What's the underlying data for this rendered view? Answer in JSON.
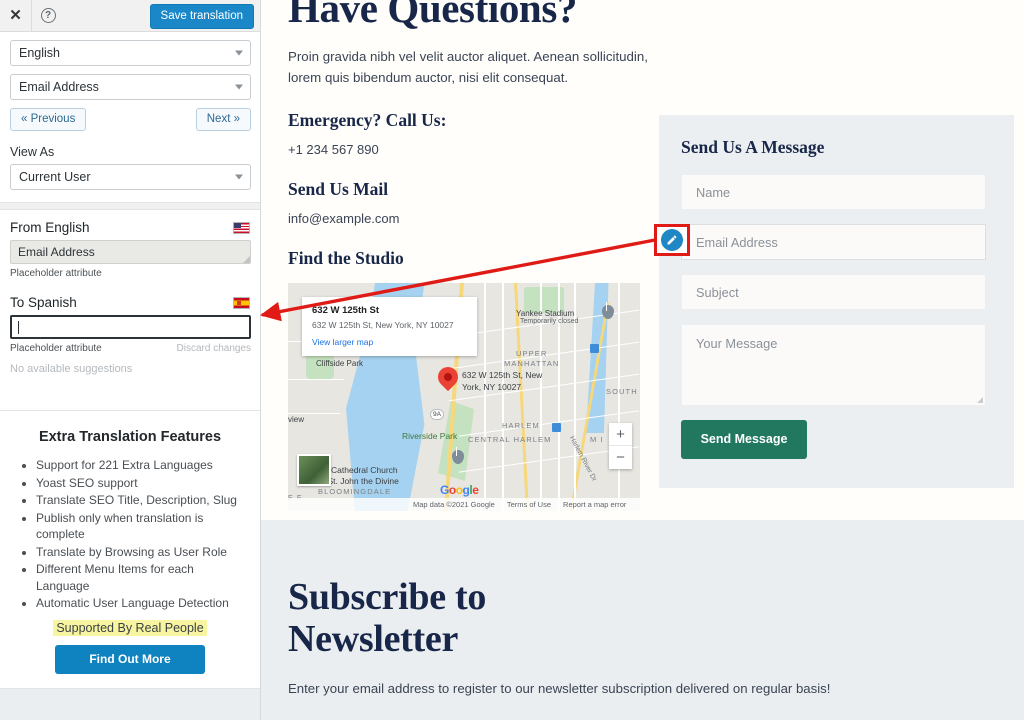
{
  "sidebar": {
    "toolbar": {
      "close_label": "✕",
      "help_label": "?",
      "save_label": "Save translation"
    },
    "language_select": "English",
    "string_select": "Email Address",
    "prev_label": "« Previous",
    "next_label": "Next »",
    "view_as_label": "View As",
    "view_as_value": "Current User",
    "translation": {
      "from_label": "From English",
      "from_value": "Email Address",
      "from_attr_note": "Placeholder attribute",
      "to_label": "To Spanish",
      "to_value": "",
      "to_attr_note": "Placeholder attribute",
      "discard_label": "Discard changes",
      "suggestions": "No available suggestions"
    },
    "extra_features": {
      "title": "Extra Translation Features",
      "items": [
        "Support for 221 Extra Languages",
        "Yoast SEO support",
        "Translate SEO Title, Description, Slug",
        "Publish only when translation is complete",
        "Translate by Browsing as User Role",
        "Different Menu Items for each Language",
        "Automatic User Language Detection"
      ],
      "supported_by": "Supported By Real People",
      "cta_label": "Find Out More"
    }
  },
  "page": {
    "heading": "Have Questions?",
    "lede": "Proin gravida nibh vel velit auctor aliquet. Aenean sollicitudin, lorem quis bibendum auctor, nisi elit consequat.",
    "emergency_label": "Emergency? Call Us:",
    "phone": "+1 234 567 890",
    "mail_label": "Send Us Mail",
    "email": "info@example.com",
    "studio_label": "Find the Studio"
  },
  "map": {
    "card_title": "632 W 125th St",
    "card_address": "632 W 125th St, New York, NY 10027",
    "view_larger": "View larger map",
    "pin_label": "632 W 125th St, New York, NY 10027",
    "labels": {
      "yankee_stadium": "Yankee Stadium",
      "yankee_status": "Temporarily closed",
      "upper": "UPPER",
      "manhattan": "MANHATTAN",
      "cliffside": "Cliffside Park",
      "riverside": "Riverside Park",
      "harlem": "HARLEM",
      "central_harlem": "CENTRAL HARLEM",
      "south": "SOUTH",
      "view": "view",
      "cathedral1": "The Cathedral Church",
      "cathedral2": "of St. John the Divine",
      "bloomingdale": "BLOOMINGDALE",
      "ff": "F F",
      "route": "9A",
      "harlem_river_dr": "Harlem River Dr",
      "mi": "M I"
    },
    "zoom_in": "+",
    "zoom_out": "−",
    "attribution": "Map data ©2021 Google",
    "terms": "Terms of Use",
    "report": "Report a map error",
    "logo": "Google"
  },
  "form": {
    "title": "Send Us A Message",
    "name_placeholder": "Name",
    "email_placeholder": "Email Address",
    "subject_placeholder": "Subject",
    "message_placeholder": "Your Message",
    "submit_label": "Send Message"
  },
  "newsletter": {
    "heading_line1": "Subscribe to",
    "heading_line2": "Newsletter",
    "body": "Enter your email address to register to our newsletter subscription delivered on regular basis!"
  },
  "colors": {
    "accent_blue": "#1a87c8",
    "brand_navy": "#182749",
    "send_green": "#21785f",
    "annotation_red": "#e01b16",
    "highlight_yellow": "#f7f5a0"
  }
}
